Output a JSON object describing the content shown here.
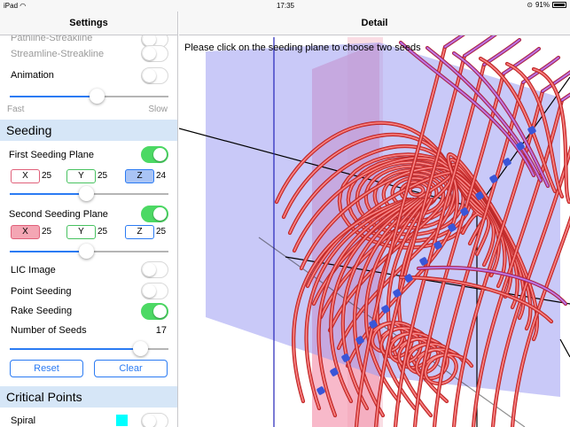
{
  "status": {
    "device": "iPad",
    "time": "17:35",
    "battery": "91%"
  },
  "master": {
    "title": "Settings",
    "rows": {
      "pathline": "Pathline-Streakline",
      "streamline": "Streamline-Streakline",
      "animation": "Animation",
      "fast": "Fast",
      "slow": "Slow"
    },
    "animation_speed": 0.55,
    "seeding": {
      "title": "Seeding",
      "first_plane": "First Seeding Plane",
      "first_on": true,
      "first_axes": [
        {
          "label": "X",
          "value": "25"
        },
        {
          "label": "Y",
          "value": "25"
        },
        {
          "label": "Z",
          "value": "24"
        }
      ],
      "first_selected": "Z",
      "first_slider": 0.48,
      "second_plane": "Second Seeding Plane",
      "second_on": true,
      "second_axes": [
        {
          "label": "X",
          "value": "25"
        },
        {
          "label": "Y",
          "value": "25"
        },
        {
          "label": "Z",
          "value": "25"
        }
      ],
      "second_selected": "X",
      "second_slider": 0.48,
      "lic_image": "LIC Image",
      "point_seeding": "Point Seeding",
      "rake_seeding": "Rake Seeding",
      "rake_on": true,
      "number_of_seeds_label": "Number of Seeds",
      "number_of_seeds": "17",
      "seeds_slider": 0.82,
      "reset": "Reset",
      "clear": "Clear"
    },
    "critical": {
      "title": "Critical Points",
      "spiral": "Spiral",
      "spiral_color": "#00ffff"
    }
  },
  "detail": {
    "title": "Detail",
    "hint": "Please click on the seeding plane to choose two seeds"
  },
  "colors": {
    "accent": "#2b7bf3",
    "toggle_on": "#4cd964",
    "section_bg": "#d6e6f7",
    "plane_blue": "#9c9cf2",
    "plane_pink": "#f6a1b8",
    "tube_red": "#e84a4a",
    "tube_purple": "#9d45d8",
    "seed_marker": "#3a56d8"
  }
}
